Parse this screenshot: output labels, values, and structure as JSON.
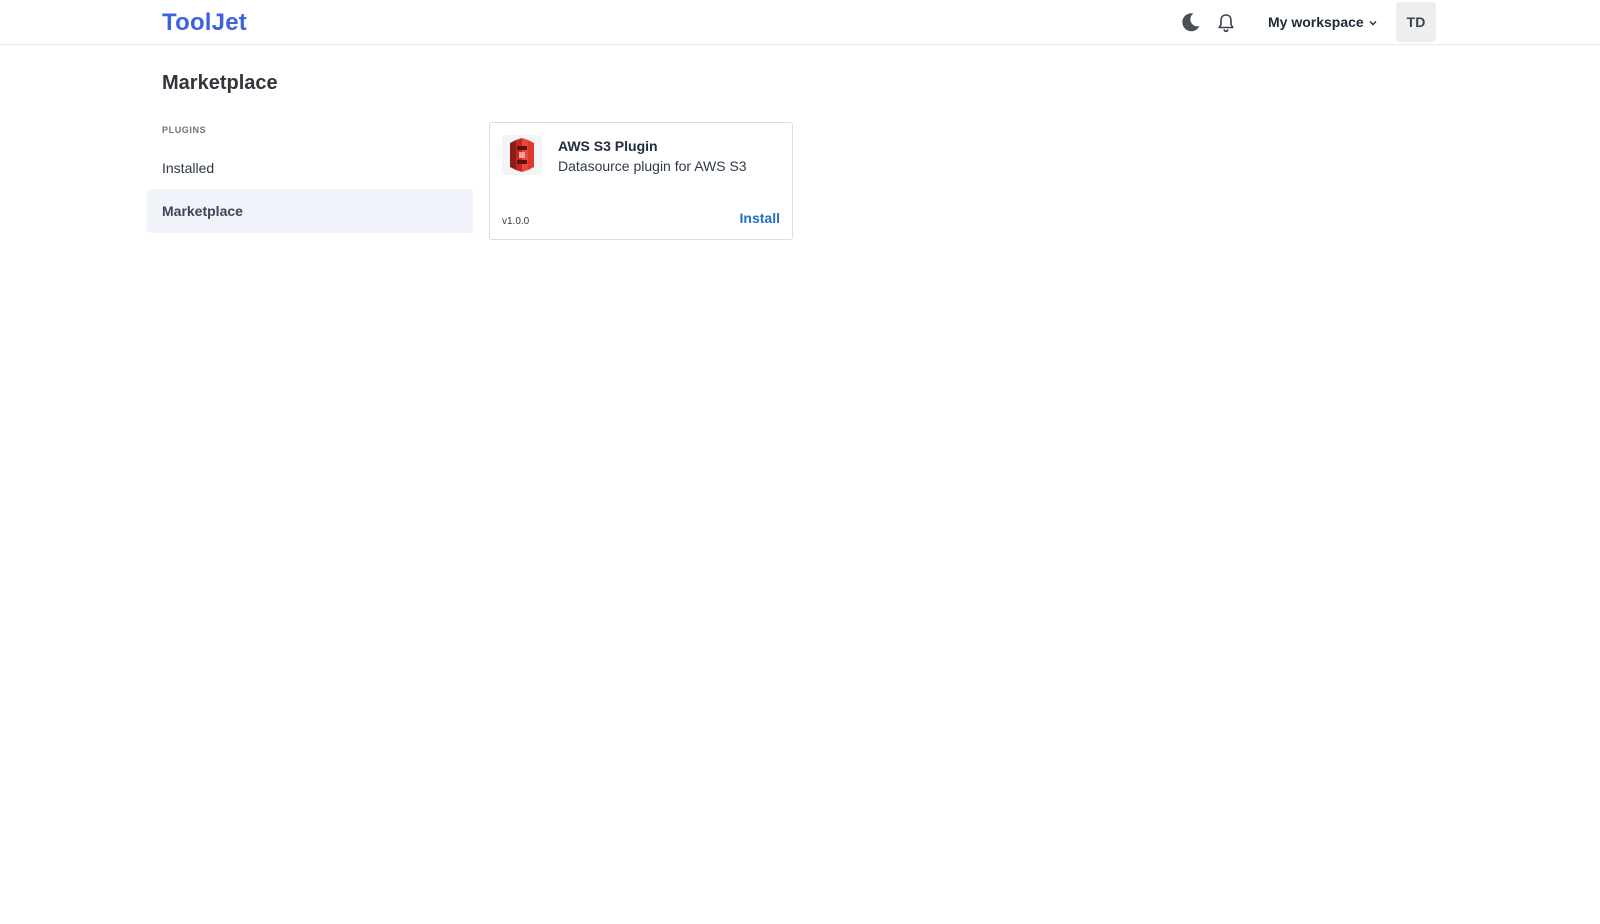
{
  "header": {
    "logo": "ToolJet",
    "workspace": "My workspace",
    "avatar_initials": "TD",
    "icons": [
      "moon-icon",
      "bell-icon",
      "chevron-down-icon"
    ]
  },
  "page": {
    "title": "Marketplace"
  },
  "sidebar": {
    "section_label": "PLUGINS",
    "items": [
      {
        "label": "Installed",
        "active": false
      },
      {
        "label": "Marketplace",
        "active": true
      }
    ]
  },
  "plugins": [
    {
      "name": "AWS S3 Plugin",
      "description": "Datasource plugin for AWS S3",
      "version": "v1.0.0",
      "action": "Install",
      "icon": "aws-s3-icon"
    }
  ],
  "colors": {
    "brand": "#3e63dd",
    "link": "#1f6fc7",
    "active_nav_bg": "#f0f4fa",
    "s3_red": "#e0372f"
  }
}
